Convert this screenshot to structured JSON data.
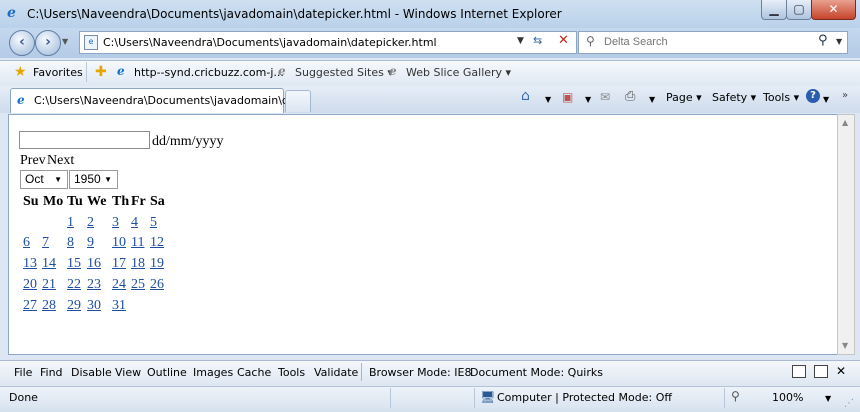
{
  "window": {
    "title": "C:\\Users\\Naveendra\\Documents\\javadomain\\datepicker.html - Windows Internet Explorer",
    "min_glyph": "▁",
    "max_glyph": "▢",
    "close_glyph": "✕"
  },
  "address": {
    "url": "C:\\Users\\Naveendra\\Documents\\javadomain\\datepicker.html",
    "search_placeholder": "Delta Search"
  },
  "favorites": {
    "label": "Favorites",
    "items": [
      {
        "label": "http--synd.cricbuzz.com-j..."
      },
      {
        "label": "Suggested Sites ▾"
      },
      {
        "label": "Web Slice Gallery ▾"
      }
    ]
  },
  "tab": {
    "label": "C:\\Users\\Naveendra\\Documents\\javadomain\\da..."
  },
  "command_bar": {
    "page": "Page ▾",
    "safety": "Safety ▾",
    "tools": "Tools ▾"
  },
  "page": {
    "date_value": "",
    "format_hint": "dd/mm/yyyy",
    "prev_label": "Prev",
    "next_label": "Next",
    "month_selected": "Oct",
    "year_selected": "1950",
    "weekdays": [
      "Su",
      "Mo",
      "Tu",
      "We",
      "Th",
      "Fr",
      "Sa"
    ],
    "weeks": [
      [
        "",
        "",
        "1",
        "2",
        "3",
        "4",
        "5"
      ],
      [
        "6",
        "7",
        "8",
        "9",
        "10",
        "11",
        "12"
      ],
      [
        "13",
        "14",
        "15",
        "16",
        "17",
        "18",
        "19"
      ],
      [
        "20",
        "21",
        "22",
        "23",
        "24",
        "25",
        "26"
      ],
      [
        "27",
        "28",
        "29",
        "30",
        "31",
        "",
        ""
      ]
    ]
  },
  "dev_toolbar": {
    "items": [
      "File",
      "Find",
      "Disable",
      "View",
      "Outline",
      "Images",
      "Cache",
      "Tools",
      "Validate"
    ],
    "browser_mode": "Browser Mode:  IE8",
    "document_mode": "Document Mode:  Quirks"
  },
  "status": {
    "text": "Done",
    "zone": "Computer | Protected Mode: Off",
    "zoom": "100%"
  },
  "colors": {
    "link": "#1f4fa0",
    "close_button": "#c5442c",
    "frame": "#b9d1ea"
  }
}
